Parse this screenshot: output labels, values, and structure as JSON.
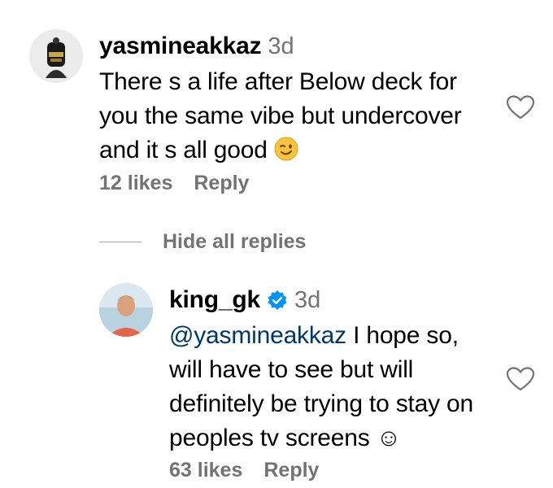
{
  "comments": [
    {
      "username": "yasmineakkaz",
      "timestamp": "3d",
      "lines": [
        "There s a life after Below deck for",
        "you the same vibe but undercover",
        "and it s all good "
      ],
      "emoji_icon": "winking-face-icon",
      "likes": "12 likes",
      "reply_label": "Reply"
    }
  ],
  "thread": {
    "hide_replies_label": "Hide all replies"
  },
  "replies": [
    {
      "username": "king_gk",
      "verified": true,
      "timestamp": "3d",
      "mention": "@yasmineakkaz",
      "lines": [
        " I hope so,",
        "will have to see but will",
        "definitely be trying to stay on",
        "peoples tv screens ☺"
      ],
      "likes": "63 likes",
      "reply_label": "Reply"
    }
  ],
  "colors": {
    "secondary_text": "#737373",
    "mention": "#00376b",
    "verified_badge": "#0095f6"
  }
}
